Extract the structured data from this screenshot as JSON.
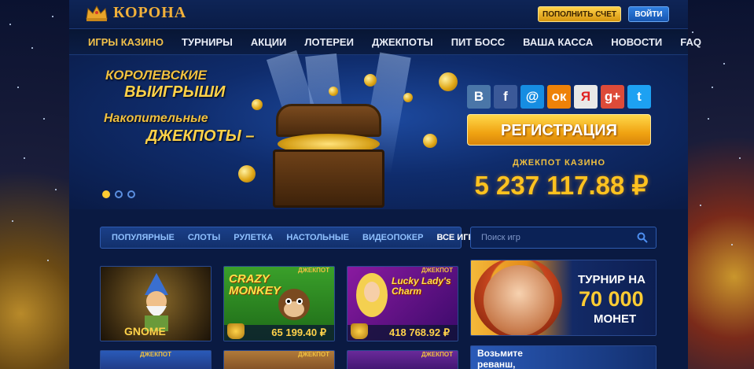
{
  "header": {
    "logo_text": "КОРОНА",
    "deposit_button": "ПОПОЛНИТЬ СЧЕТ",
    "login_button": "ВОЙТИ"
  },
  "nav": {
    "items": [
      {
        "label": "ИГРЫ КАЗИНО",
        "active": true
      },
      {
        "label": "ТУРНИРЫ"
      },
      {
        "label": "АКЦИИ"
      },
      {
        "label": "ЛОТЕРЕИ"
      },
      {
        "label": "ДЖЕКПОТЫ"
      },
      {
        "label": "ПИТ БОСС"
      },
      {
        "label": "ВАША КАССА"
      },
      {
        "label": "НОВОСТИ"
      },
      {
        "label": "FAQ"
      }
    ]
  },
  "banner": {
    "promo_line1": "КОРОЛЕВСКИЕ",
    "promo_line2": "ВЫИГРЫШИ",
    "promo_line3": "Накопительные",
    "promo_line4": "ДЖЕКПОТЫ –",
    "slides_active": 1,
    "slides_total": 3,
    "social": [
      {
        "name": "vk-icon",
        "glyph": "B",
        "color": "#4a76a8"
      },
      {
        "name": "facebook-icon",
        "glyph": "f",
        "color": "#3b5998"
      },
      {
        "name": "mailru-icon",
        "glyph": "@",
        "color": "#168de2"
      },
      {
        "name": "odnoklassniki-icon",
        "glyph": "ок",
        "color": "#ee8208"
      },
      {
        "name": "yandex-icon",
        "glyph": "Я",
        "color": "#e8e8e8"
      },
      {
        "name": "googleplus-icon",
        "glyph": "g+",
        "color": "#dd4b39"
      },
      {
        "name": "twitter-icon",
        "glyph": "t",
        "color": "#1da1f2"
      }
    ],
    "register_button": "РЕГИСТРАЦИЯ",
    "jackpot_label": "ДЖЕКПОТ КАЗИНО",
    "jackpot_value": "5 237 117.88 ₽"
  },
  "games": {
    "tabs": [
      {
        "label": "ПОПУЛЯРНЫЕ"
      },
      {
        "label": "СЛОТЫ"
      },
      {
        "label": "РУЛЕТКА"
      },
      {
        "label": "НАСТОЛЬНЫЕ"
      },
      {
        "label": "ВИДЕОПОКЕР"
      },
      {
        "label": "ВСЕ ИГРЫ",
        "active": true
      }
    ],
    "search_placeholder": "Поиск игр",
    "tiles": [
      {
        "title": "GNOME",
        "jackpot_tag": "",
        "price": ""
      },
      {
        "title": "CRAZY MONKEY",
        "jackpot_tag": "ДЖЕКПОТ",
        "price": "65 199.40 ₽"
      },
      {
        "title": "Lucky Lady's Charm",
        "jackpot_tag": "ДЖЕКПОТ",
        "price": "418 768.92 ₽"
      }
    ],
    "row2_tags": [
      "ДЖЕКПОТ",
      "ДЖЕКПОТ",
      "ДЖЕКПОТ"
    ]
  },
  "promo": {
    "line1": "ТУРНИР НА",
    "line2": "70 000",
    "line3": "МОНЕТ",
    "promo2": "Возьмите реванш,"
  },
  "colors": {
    "accent_gold": "#ffc21f",
    "nav_active": "#f2c14a",
    "login_blue": "#1756b0"
  }
}
